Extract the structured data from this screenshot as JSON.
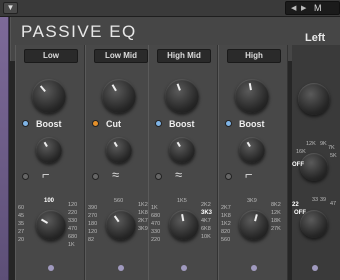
{
  "host": {
    "collapse_icon": "triangle-down-icon",
    "preset_prev": "◀",
    "preset_next": "▶",
    "preset_name": "M"
  },
  "plugin": {
    "title": "PASSIVE EQ",
    "channel": "Left"
  },
  "bands": [
    {
      "label": "Low",
      "mode": "Boost",
      "led": "blue",
      "freq_left": [
        "60",
        "45",
        "35",
        "27",
        "20"
      ],
      "freq_right": [
        "120",
        "220",
        "330",
        "470",
        "680",
        "1K"
      ],
      "freq_top": "100",
      "freq_selected": "100"
    },
    {
      "label": "Low Mid",
      "mode": "Cut",
      "led": "orange",
      "freq_left": [
        "390",
        "270",
        "180",
        "120",
        "82"
      ],
      "freq_right": [
        "1K2",
        "1K8",
        "2K7",
        "3K9"
      ],
      "freq_top": "560",
      "freq_selected": "820"
    },
    {
      "label": "High Mid",
      "mode": "Boost",
      "led": "blue",
      "freq_left": [
        "1K",
        "680",
        "470",
        "330",
        "220"
      ],
      "freq_right": [
        "2K2",
        "3K3",
        "4K7",
        "6K8",
        "10K"
      ],
      "freq_top": "1K5",
      "freq_selected": "3K3"
    },
    {
      "label": "High",
      "mode": "Boost",
      "led": "blue",
      "freq_left": [
        "2K7",
        "1K8",
        "1K2",
        "820",
        "560"
      ],
      "freq_right": [
        "8K2",
        "12K",
        "18K",
        "27K"
      ],
      "freq_top": "3K9",
      "freq_selected": "5K6"
    }
  ],
  "right": {
    "off_label": "OFF",
    "freqs_top": [
      "12K",
      "9K",
      "7K",
      "16K",
      "5K"
    ],
    "off2": "OFF",
    "freqs_bottom": [
      "33",
      "39",
      "47",
      "22"
    ],
    "freq_selected": "22"
  }
}
